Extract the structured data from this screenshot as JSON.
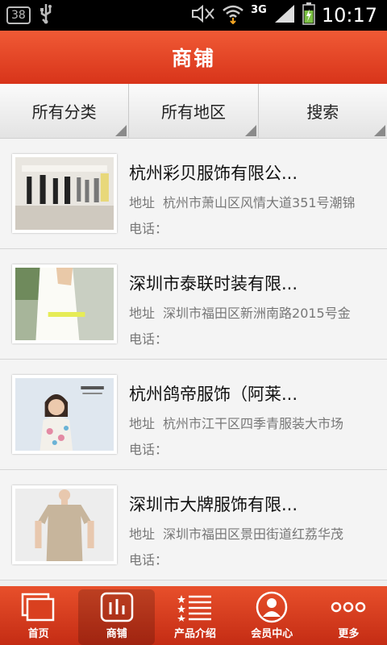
{
  "status": {
    "badge": "38",
    "net": "3G",
    "time": "10:17"
  },
  "header": {
    "title": "商铺"
  },
  "filters": [
    {
      "label": "所有分类"
    },
    {
      "label": "所有地区"
    },
    {
      "label": "搜索"
    }
  ],
  "shops": [
    {
      "name": "杭州彩贝服饰有限公...",
      "addr_label": "地址",
      "addr": "杭州市萧山区风情大道351号潮锦",
      "phone": "电话：",
      "thumb": "store-interior-icon"
    },
    {
      "name": "深圳市泰联时装有限...",
      "addr_label": "地址",
      "addr": "深圳市福田区新洲南路2015号金",
      "phone": "电话：",
      "thumb": "fashion-photo-icon"
    },
    {
      "name": "杭州鸽帝服饰（阿莱...",
      "addr_label": "地址",
      "addr": "杭州市江干区四季青服装大市场",
      "phone": "电话：",
      "thumb": "brand-model-icon"
    },
    {
      "name": "深圳市大牌服饰有限...",
      "addr_label": "地址",
      "addr": "深圳市福田区景田街道红荔华茂",
      "phone": "电话：",
      "thumb": "model-dress-icon"
    }
  ],
  "nav": [
    {
      "label": "首页",
      "icon": "home-icon",
      "active": false
    },
    {
      "label": "商铺",
      "icon": "shop-icon",
      "active": true
    },
    {
      "label": "产品介绍",
      "icon": "product-list-icon",
      "active": false
    },
    {
      "label": "会员中心",
      "icon": "member-icon",
      "active": false
    },
    {
      "label": "更多",
      "icon": "more-icon",
      "active": false
    }
  ],
  "colors": {
    "accent": "#e0401f",
    "nav_bg": "#d53a1c"
  }
}
